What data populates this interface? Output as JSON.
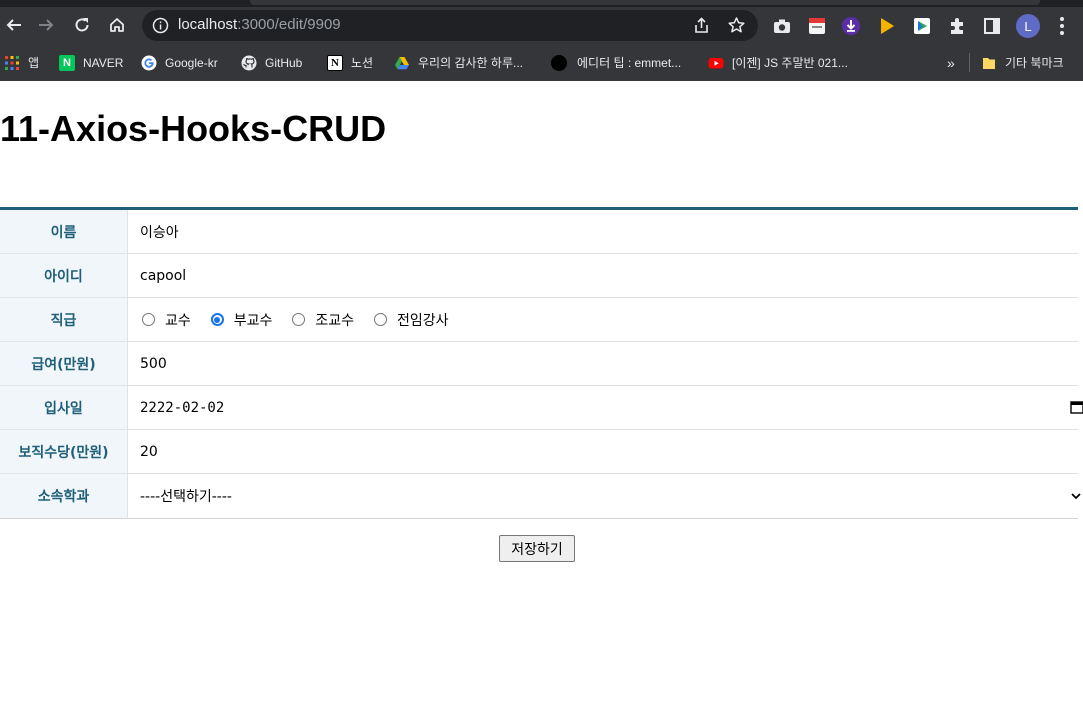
{
  "browser": {
    "url_host": "localhost",
    "url_rest": ":3000/edit/9909",
    "avatar_letter": "L",
    "bookmarks": [
      {
        "label": "앱",
        "icon": "apps-grid-icon"
      },
      {
        "label": "NAVER",
        "icon": "naver-icon"
      },
      {
        "label": "Google-kr",
        "icon": "google-icon"
      },
      {
        "label": "GitHub",
        "icon": "github-icon"
      },
      {
        "label": "노션",
        "icon": "notion-icon"
      },
      {
        "label": "우리의 감사한 하루...",
        "icon": "google-drive-icon"
      },
      {
        "label": "에디터 팁 : emmet...",
        "icon": "black-circle-icon"
      },
      {
        "label": "[이젠] JS 주말반 021...",
        "icon": "youtube-icon"
      }
    ],
    "overflow_label": "»",
    "other_bookmarks": "기타 북마크"
  },
  "page": {
    "title": "11-Axios-Hooks-CRUD"
  },
  "form": {
    "name_label": "이름",
    "name_value": "이승아",
    "id_label": "아이디",
    "id_value": "capool",
    "position_label": "직급",
    "positions": [
      {
        "label": "교수",
        "checked": false
      },
      {
        "label": "부교수",
        "checked": true
      },
      {
        "label": "조교수",
        "checked": false
      },
      {
        "label": "전임강사",
        "checked": false
      }
    ],
    "salary_label": "급여(만원)",
    "salary_value": "500",
    "hiredate_label": "입사일",
    "hiredate_value": "2222-02-02",
    "commission_label": "보직수당(만원)",
    "commission_value": "20",
    "department_label": "소속학과",
    "department_value": "----선택하기----",
    "save_label": "저장하기"
  },
  "colors": {
    "accent": "#1f5f7a",
    "header_cell_bg": "#f0f6f9",
    "radio_checked": "#1a73e8"
  }
}
